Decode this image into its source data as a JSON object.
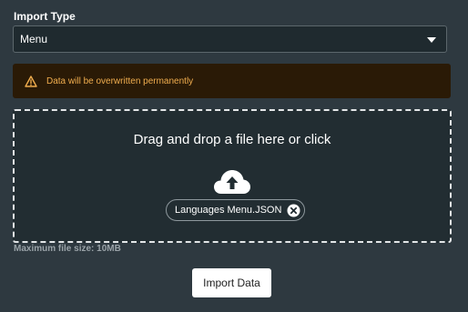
{
  "import_type": {
    "label": "Import Type",
    "selected": "Menu"
  },
  "warning": {
    "text": "Data will be overwritten permanently",
    "icon": "warning-triangle-icon",
    "color": "#f0ad4e"
  },
  "dropzone": {
    "title": "Drag and drop a file here or click",
    "icon": "cloud-upload-icon",
    "file_name": "Languages Menu.JSON"
  },
  "max_size": "Maximum file size: 10MB",
  "import_button": "Import Data"
}
